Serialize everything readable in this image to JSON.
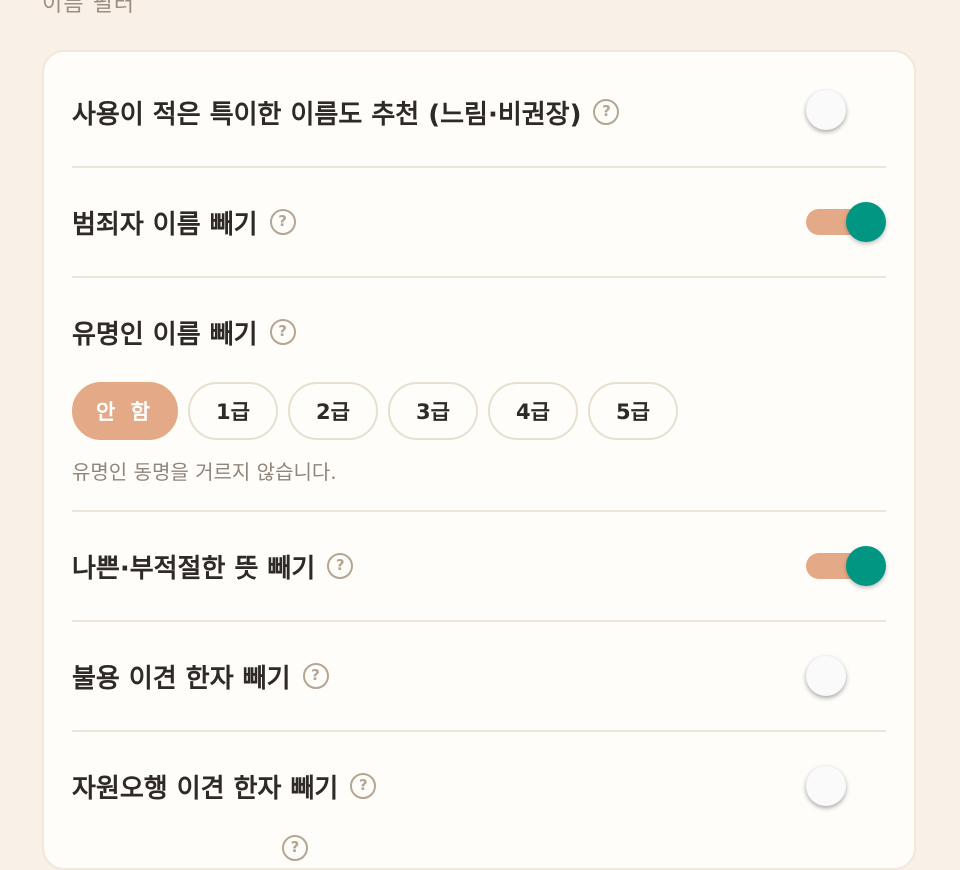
{
  "section": {
    "title": "이름 필터"
  },
  "rows": [
    {
      "label": "사용이 적은 특이한 이름도 추천 (느림·비권장)",
      "toggle": "off"
    },
    {
      "label": "범죄자 이름 빼기",
      "toggle": "on"
    },
    {
      "label": "유명인 이름 빼기",
      "grades": [
        "안 함",
        "1급",
        "2급",
        "3급",
        "4급",
        "5급"
      ],
      "selected_grade": "안 함",
      "hint": "유명인 동명을 거르지 않습니다."
    },
    {
      "label": "나쁜·부적절한 뜻 빼기",
      "toggle": "on"
    },
    {
      "label": "불용 이견 한자 빼기",
      "toggle": "off"
    },
    {
      "label": "자원오행 이견 한자 빼기",
      "toggle": "off"
    }
  ],
  "help_glyph": "?",
  "colors": {
    "accent": "#e4aa87",
    "toggle_on": "#009682",
    "background": "#f9f0e7",
    "card": "#fffdf9"
  }
}
